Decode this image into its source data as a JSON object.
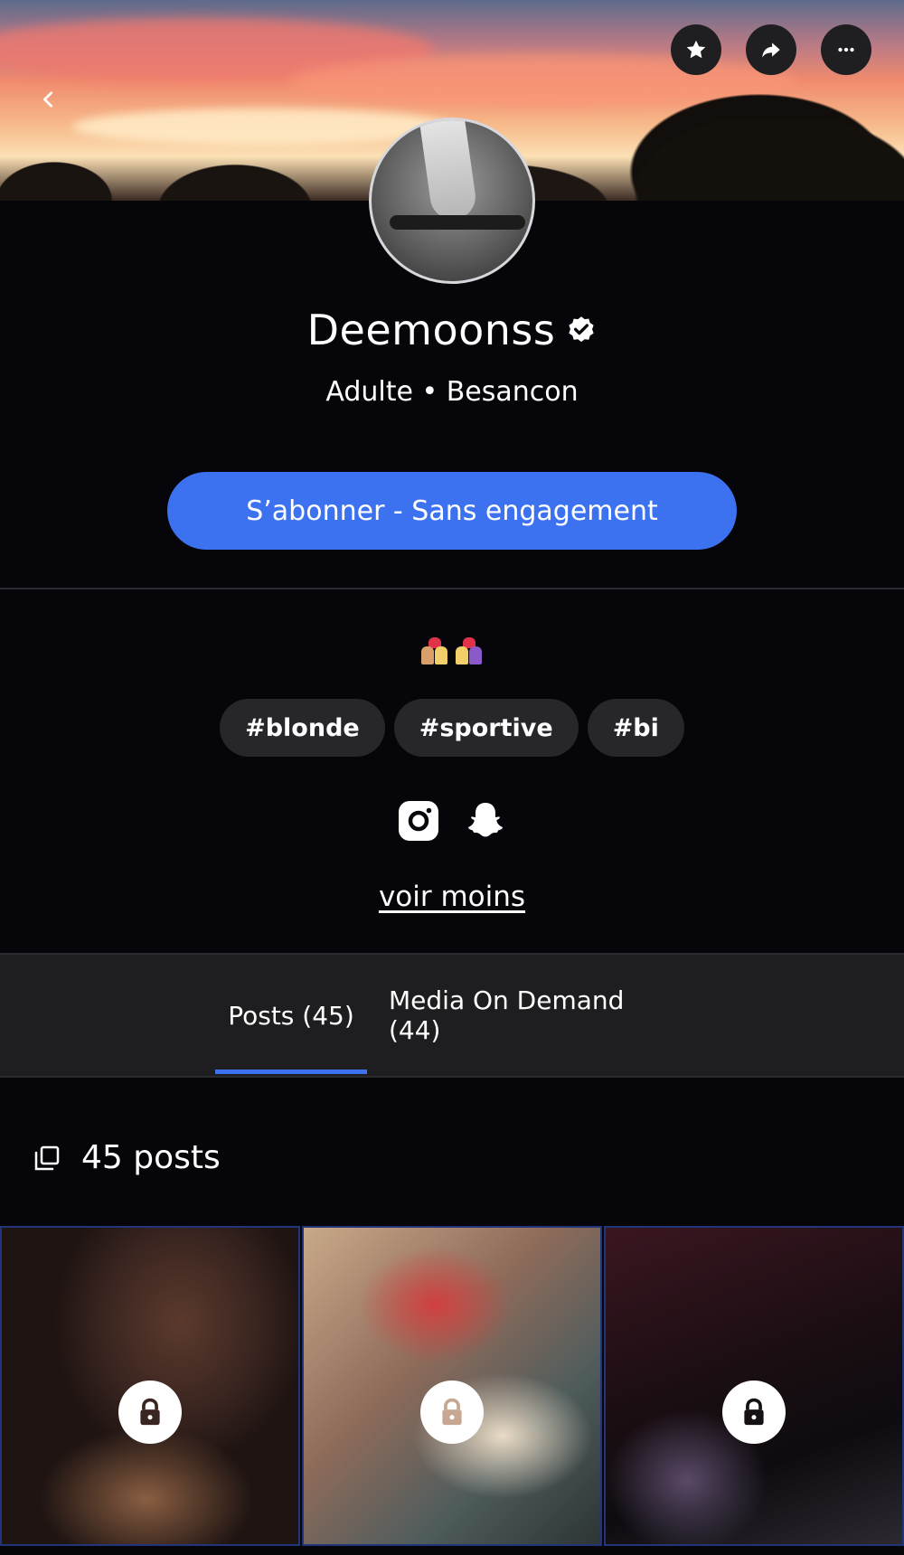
{
  "profile": {
    "name": "Deemoonss",
    "subtitle": "Adulte • Besancon",
    "subscribe_label": "S’abonner - Sans engagement",
    "tags": [
      "#blonde",
      "#sportive",
      "#bi"
    ],
    "toggle_label": "voir moins"
  },
  "header": {
    "actions": [
      "star-icon",
      "share-icon",
      "more-icon"
    ]
  },
  "tabs": [
    {
      "label": "Posts (45)",
      "active": true
    },
    {
      "label": "Media On Demand (44)",
      "active": false
    }
  ],
  "posts": {
    "count_label": "45 posts",
    "tiles": [
      {
        "locked": true
      },
      {
        "locked": true
      },
      {
        "locked": true
      }
    ]
  },
  "socials": [
    "instagram-icon",
    "snapchat-icon"
  ],
  "colors": {
    "accent": "#3c72f0",
    "background": "#05050a",
    "tab_bar": "#1e1e20",
    "tag_bg": "#27272b"
  }
}
